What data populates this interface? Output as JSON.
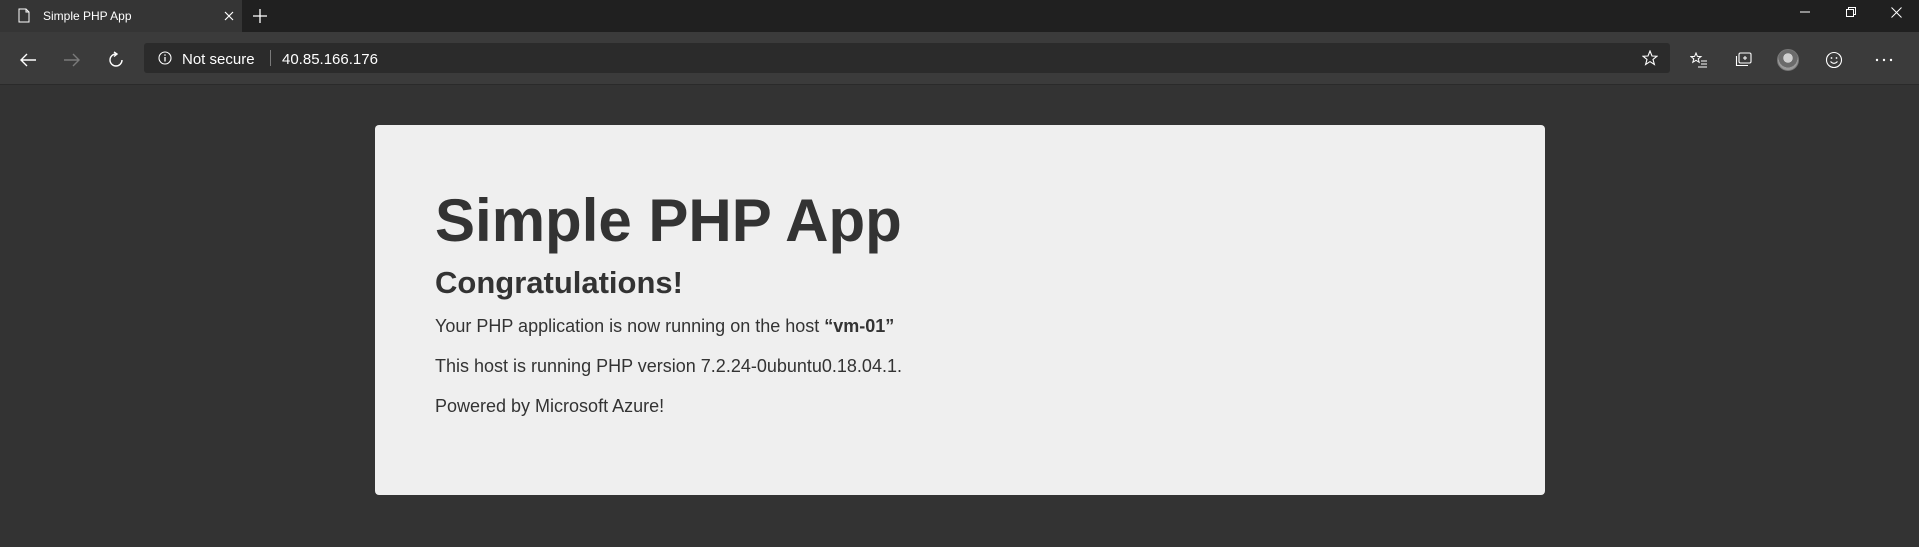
{
  "browser": {
    "tab": {
      "title": "Simple PHP App"
    },
    "address_bar": {
      "security_label": "Not secure",
      "url": "40.85.166.176"
    },
    "colors": {
      "tab_bar": "#202020",
      "toolbar": "#3b3b3b",
      "address_field": "#2b2b2b",
      "page_background": "#333333",
      "card_background": "#efefef",
      "text": "#333333"
    }
  },
  "page": {
    "title": "Simple PHP App",
    "subtitle": "Congratulations!",
    "line1_prefix": "Your PHP application is now running on the host ",
    "host_name": "“vm-01”",
    "line2": "This host is running PHP version 7.2.24-0ubuntu0.18.04.1.",
    "line3": "Powered by Microsoft Azure!"
  },
  "icons": {
    "tab": "page-icon",
    "tab_close": "close-icon",
    "new_tab": "plus-icon",
    "back": "arrow-left-icon",
    "forward": "arrow-right-icon",
    "refresh": "refresh-icon",
    "info": "info-icon",
    "favorite": "star-icon",
    "favorites_bar": "favorites-list-icon",
    "collections": "collections-icon",
    "profile": "avatar",
    "feedback": "smiley-icon",
    "menu": "more-icon",
    "minimize": "minimize-icon",
    "restore": "restore-icon",
    "close": "close-window-icon"
  }
}
